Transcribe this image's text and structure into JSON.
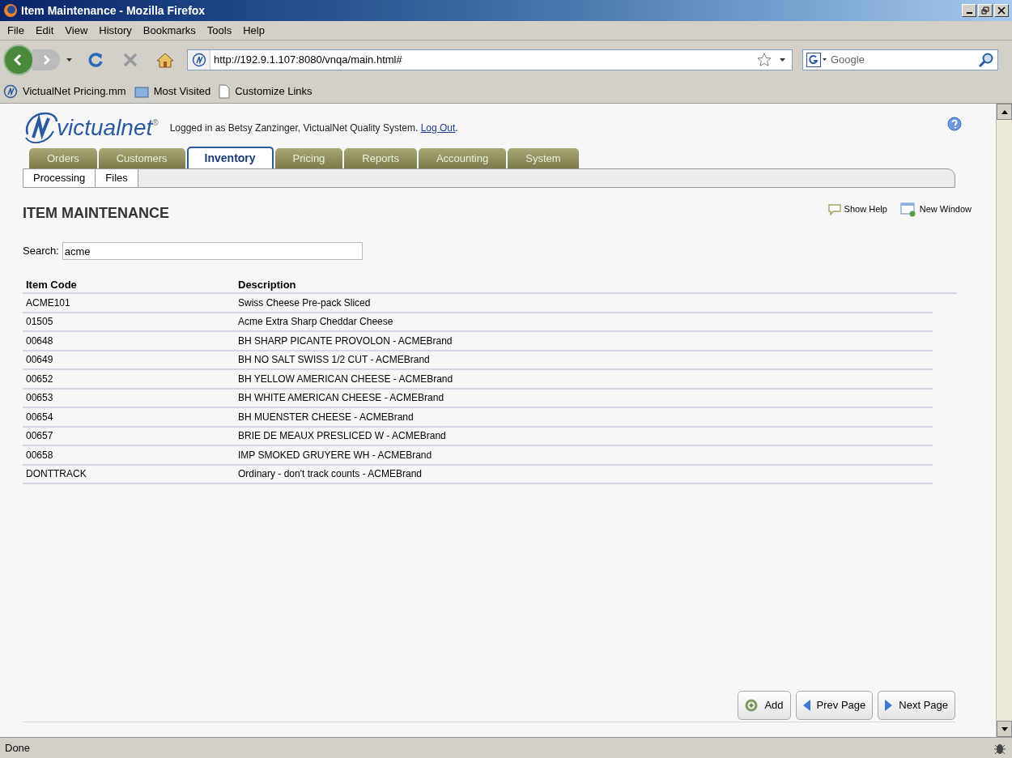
{
  "window": {
    "title": "Item Maintenance - Mozilla Firefox"
  },
  "menu": [
    "File",
    "Edit",
    "View",
    "History",
    "Bookmarks",
    "Tools",
    "Help"
  ],
  "address_bar": {
    "value": "http://192.9.1.107:8080/vnqa/main.html#"
  },
  "search_box": {
    "placeholder": "Google"
  },
  "bookmarks": [
    "VictualNet Pricing.mm",
    "Most Visited",
    "Customize Links"
  ],
  "header": {
    "logo": "victualnet",
    "registered": "®",
    "login_text": "Logged in as Betsy Zanzinger, VictualNet Quality System.",
    "logout_link": "Log Out",
    "after_link": "."
  },
  "tabs": [
    {
      "label": "Orders",
      "selected": false
    },
    {
      "label": "Customers",
      "selected": false
    },
    {
      "label": "Inventory",
      "selected": true
    },
    {
      "label": "Pricing",
      "selected": false
    },
    {
      "label": "Reports",
      "selected": false
    },
    {
      "label": "Accounting",
      "selected": false
    },
    {
      "label": "System",
      "selected": false
    }
  ],
  "subtabs": [
    "Processing",
    "Files"
  ],
  "page": {
    "title": "ITEM MAINTENANCE",
    "show_help": "Show Help",
    "new_window": "New Window"
  },
  "search": {
    "label": "Search:",
    "value": "acme"
  },
  "table": {
    "columns": [
      "Item Code",
      "Description"
    ],
    "rows": [
      [
        "ACME101",
        "Swiss Cheese Pre-pack Sliced"
      ],
      [
        "01505",
        "Acme Extra Sharp Cheddar Cheese"
      ],
      [
        "00648",
        "BH SHARP PICANTE PROVOLON - ACMEBrand"
      ],
      [
        "00649",
        "BH NO SALT SWISS 1/2 CUT - ACMEBrand"
      ],
      [
        "00652",
        "BH YELLOW AMERICAN CHEESE - ACMEBrand"
      ],
      [
        "00653",
        "BH WHITE AMERICAN CHEESE - ACMEBrand"
      ],
      [
        "00654",
        "BH MUENSTER CHEESE - ACMEBrand"
      ],
      [
        "00657",
        "BRIE DE MEAUX PRESLICED W - ACMEBrand"
      ],
      [
        "00658",
        "IMP SMOKED GRUYERE WH - ACMEBrand"
      ],
      [
        "DONTTRACK",
        "Ordinary - don't track counts - ACMEBrand"
      ]
    ]
  },
  "buttons": [
    {
      "kind": "add",
      "label": "Add"
    },
    {
      "kind": "prev",
      "label": "Prev Page"
    },
    {
      "kind": "next",
      "label": "Next Page"
    }
  ],
  "status_bar": {
    "text": "Done"
  }
}
